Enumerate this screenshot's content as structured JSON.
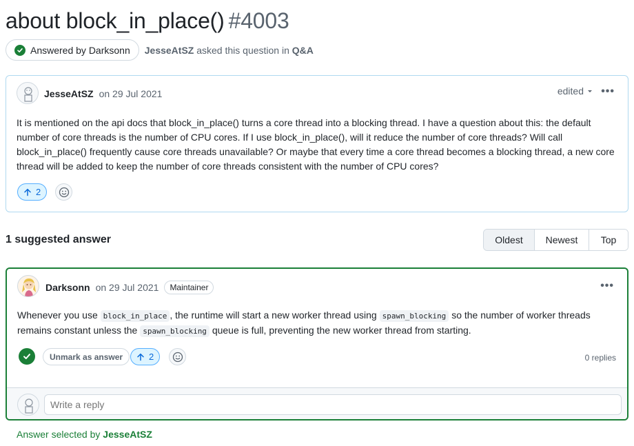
{
  "discussion": {
    "title": "about block_in_place()",
    "number": "#4003",
    "answered_badge": "Answered by Darksonn",
    "asker": "JesseAtSZ",
    "asked_text": "asked this question in",
    "category": "Q&A"
  },
  "question": {
    "author": "JesseAtSZ",
    "date": "on 29 Jul 2021",
    "edited_label": "edited",
    "body": "It is mentioned on the api docs that block_in_place() turns a core thread into a blocking thread. I have a question about this: the default number of core threads is the number of CPU cores. If I use block_in_place(), will it reduce the number of core threads? Will call block_in_place() frequently cause core threads unavailable? Or maybe that every time a core thread becomes a blocking thread, a new core thread will be added to keep the number of core threads consistent with the number of CPU cores?",
    "upvotes": "2"
  },
  "answers_header": {
    "count_label": "1 suggested answer",
    "sort_options": [
      "Oldest",
      "Newest",
      "Top"
    ],
    "active_sort": "Oldest"
  },
  "answer": {
    "author": "Darksonn",
    "date": "on 29 Jul 2021",
    "role_badge": "Maintainer",
    "body_part1": "Whenever you use ",
    "code1": "block_in_place",
    "body_part2": ", the runtime will start a new worker thread using ",
    "code2": "spawn_blocking",
    "body_part3": " so the number of worker threads remains constant unless the ",
    "code3": "spawn_blocking",
    "body_part4": " queue is full, preventing the new worker thread from starting.",
    "unmark_label": "Unmark as answer",
    "upvotes": "2",
    "replies": "0 replies",
    "reply_placeholder": "Write a reply"
  },
  "footer": {
    "selected_text": "Answer selected by",
    "selected_by": "JesseAtSZ"
  },
  "colors": {
    "accent_green": "#1a7f37",
    "accent_blue": "#0969da",
    "question_border": "#afd9f0"
  }
}
